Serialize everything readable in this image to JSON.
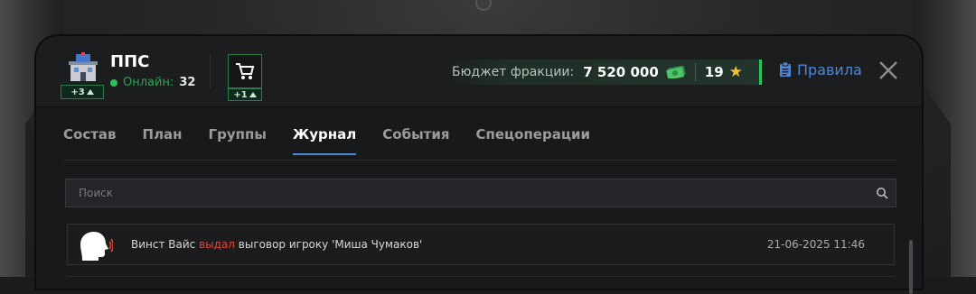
{
  "header": {
    "faction_name": "ППС",
    "faction_badge": "+3",
    "online_label": "Онлайн:",
    "online_count": "32",
    "cart_badge": "+1",
    "budget_label": "Бюджет фракции:",
    "budget_value": "7 520 000",
    "stars": "19",
    "rules_label": "Правила"
  },
  "tabs": [
    {
      "label": "Состав"
    },
    {
      "label": "План"
    },
    {
      "label": "Группы"
    },
    {
      "label": "Журнал"
    },
    {
      "label": "События"
    },
    {
      "label": "Спецоперации"
    }
  ],
  "search": {
    "placeholder": "Поиск"
  },
  "log": [
    {
      "actor": "Винст Вайс",
      "action": "выдал",
      "rest": "выговор игроку 'Миша Чумаков'",
      "time": "21-06-2025 11:46"
    }
  ],
  "colors": {
    "accent_blue": "#4f86d8",
    "online_green": "#2fc15a",
    "action_red": "#e0473e",
    "star_gold": "#f0c22f"
  }
}
